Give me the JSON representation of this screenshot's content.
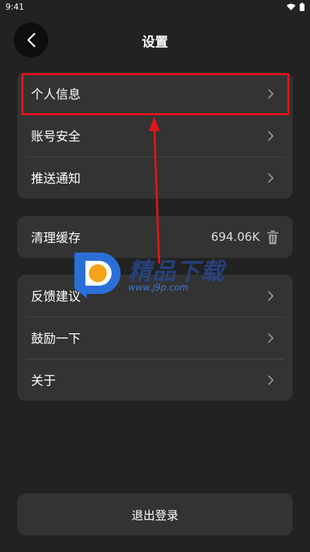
{
  "status_bar": {
    "time": "9:41"
  },
  "header": {
    "title": "设置"
  },
  "group1": {
    "items": [
      {
        "label": "个人信息"
      },
      {
        "label": "账号安全"
      },
      {
        "label": "推送通知"
      }
    ]
  },
  "group2": {
    "cache_label": "清理缓存",
    "cache_size": "694.06K"
  },
  "group3": {
    "items": [
      {
        "label": "反馈建议"
      },
      {
        "label": "鼓励一下"
      },
      {
        "label": "关于"
      }
    ]
  },
  "footer": {
    "logout_label": "退出登录"
  },
  "watermark": {
    "title": "精品下载",
    "url": "www.j9p.com"
  },
  "icons": {
    "back": "chevron-left-icon",
    "row_arrow": "chevron-right-icon",
    "clear_cache": "trash-icon"
  },
  "colors": {
    "background": "#222222",
    "card": "#333333",
    "highlight": "#e0141b"
  }
}
